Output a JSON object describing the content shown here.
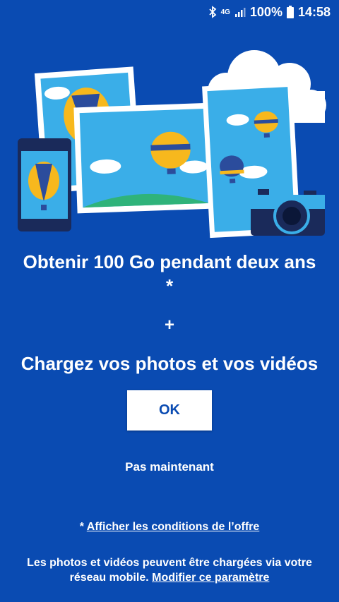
{
  "status_bar": {
    "network": "4G",
    "battery": "100%",
    "time": "14:58"
  },
  "illustration": {
    "icons": [
      "bluetooth-icon",
      "signal-icon",
      "battery-icon",
      "cloud-icon",
      "photo-frame-icon",
      "phone-icon",
      "camera-icon",
      "hot-air-balloon-icon"
    ]
  },
  "offer": {
    "headline": "Obtenir 100 Go pendant deux ans",
    "asterisk": "*",
    "plus": "+",
    "subheadline": "Chargez vos photos et vos vidéos"
  },
  "actions": {
    "ok_label": "OK",
    "later_label": "Pas maintenant"
  },
  "terms": {
    "prefix": "* ",
    "link": "Afficher les conditions de l’offre"
  },
  "footer": {
    "text": "Les photos et vidéos peuvent être chargées via votre réseau mobile.",
    "link": "Modifier ce paramètre"
  },
  "colors": {
    "background": "#0a4bb2",
    "button_bg": "#ffffff",
    "button_text": "#0a4bb2"
  }
}
